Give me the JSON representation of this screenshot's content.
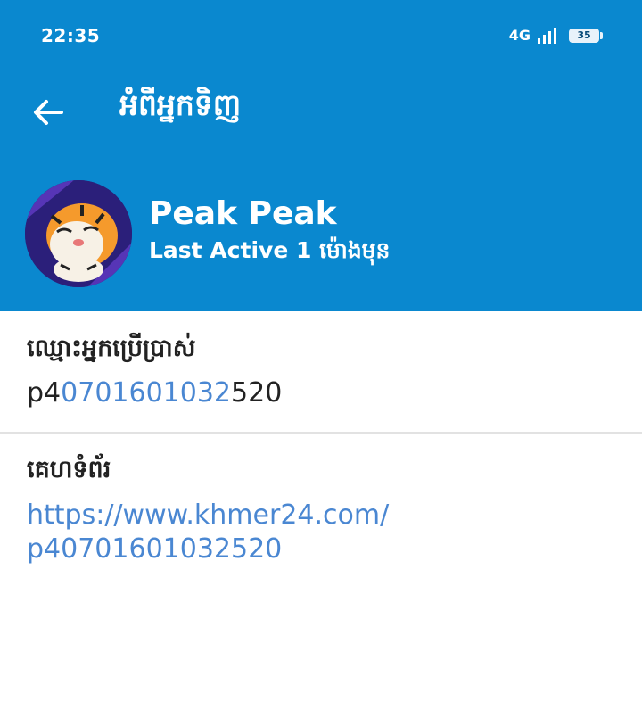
{
  "status_bar": {
    "time": "22:35",
    "network": "4G",
    "battery": "35"
  },
  "app_bar": {
    "title": "អំពីអ្នកទិញ",
    "back_icon": "arrow-left-icon"
  },
  "profile": {
    "name": "Peak Peak",
    "last_active": "Last Active 1 ម៉ោងមុន",
    "avatar_icon": "tiger-avatar"
  },
  "username_section": {
    "label": "ឈ្មោះអ្នកប្រើប្រាស់",
    "value_prefix": "p4",
    "value_link": "0701601032",
    "value_suffix": "520"
  },
  "website_section": {
    "label": "គេហទំព័រ",
    "url_line1": "https://www.khmer24.com/",
    "url_line2": "p40701601032520"
  },
  "colors": {
    "primary": "#0a88cf",
    "link": "#4a87d2"
  }
}
